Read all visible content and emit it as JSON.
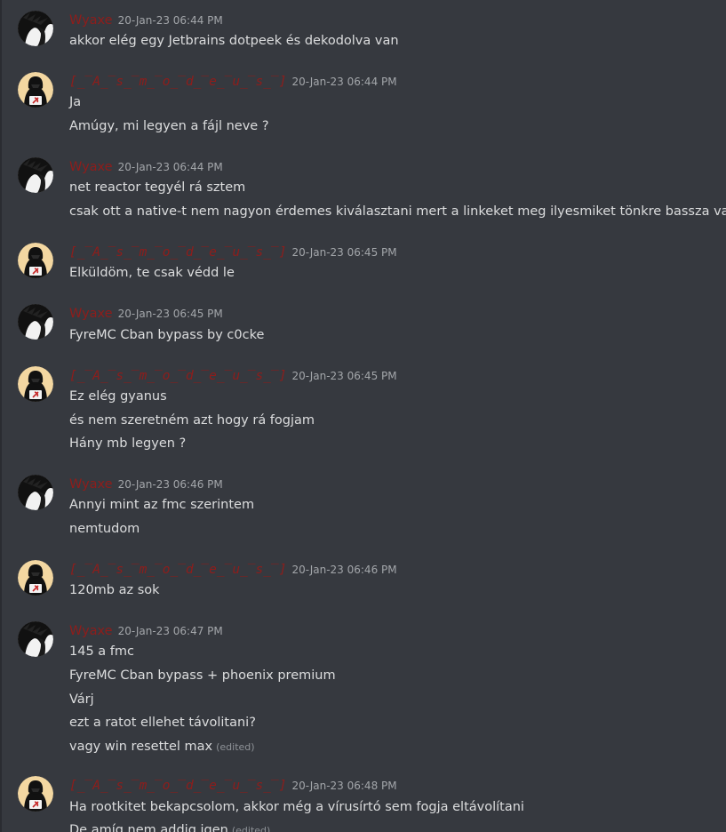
{
  "messages": [
    {
      "author": "Wyaxe",
      "avatar": "wyaxe",
      "timestamp": "20-Jan-23 06:44 PM",
      "lines": [
        {
          "text": "akkor elég egy Jetbrains dotpeek és dekodolva van"
        }
      ]
    },
    {
      "author": "[̲̅A̲̅s̲̅m̲̅o̲̅d̲̅e̲̅u̲̅s̲̅]",
      "avatar": "asmodeus",
      "timestamp": "20-Jan-23 06:44 PM",
      "lines": [
        {
          "text": "Ja"
        },
        {
          "text": "Amúgy, mi legyen a fájl neve ?"
        }
      ]
    },
    {
      "author": "Wyaxe",
      "avatar": "wyaxe",
      "timestamp": "20-Jan-23 06:44 PM",
      "lines": [
        {
          "text": "net reactor tegyél rá sztem"
        },
        {
          "text": "csak ott a native-t nem nagyon érdemes kiválasztani mert a linkeket meg ilyesmiket tönkre bassza valamiért"
        }
      ]
    },
    {
      "author": "[̲̅A̲̅s̲̅m̲̅o̲̅d̲̅e̲̅u̲̅s̲̅]",
      "avatar": "asmodeus",
      "timestamp": "20-Jan-23 06:45 PM",
      "lines": [
        {
          "text": "Elküldöm, te csak védd le"
        }
      ]
    },
    {
      "author": "Wyaxe",
      "avatar": "wyaxe",
      "timestamp": "20-Jan-23 06:45 PM",
      "lines": [
        {
          "text": "FyreMC Cban bypass by c0cke"
        }
      ]
    },
    {
      "author": "[̲̅A̲̅s̲̅m̲̅o̲̅d̲̅e̲̅u̲̅s̲̅]",
      "avatar": "asmodeus",
      "timestamp": "20-Jan-23 06:45 PM",
      "lines": [
        {
          "text": "Ez elég gyanus"
        },
        {
          "text": "és nem szeretném azt hogy rá fogjam"
        },
        {
          "text": "Hány mb legyen ?"
        }
      ]
    },
    {
      "author": "Wyaxe",
      "avatar": "wyaxe",
      "timestamp": "20-Jan-23 06:46 PM",
      "lines": [
        {
          "text": "Annyi mint az fmc szerintem"
        },
        {
          "text": "nemtudom"
        }
      ]
    },
    {
      "author": "[̲̅A̲̅s̲̅m̲̅o̲̅d̲̅e̲̅u̲̅s̲̅]",
      "avatar": "asmodeus",
      "timestamp": "20-Jan-23 06:46 PM",
      "lines": [
        {
          "text": "120mb az sok"
        }
      ]
    },
    {
      "author": "Wyaxe",
      "avatar": "wyaxe",
      "timestamp": "20-Jan-23 06:47 PM",
      "lines": [
        {
          "text": "145 a fmc"
        },
        {
          "text": "FyreMC Cban bypass + phoenix premium"
        },
        {
          "text": "Várj"
        },
        {
          "text": "ezt a ratot ellehet távolitani?"
        },
        {
          "text": "vagy win resettel max",
          "edited": "(edited)"
        }
      ]
    },
    {
      "author": "[̲̅A̲̅s̲̅m̲̅o̲̅d̲̅e̲̅u̲̅s̲̅]",
      "avatar": "asmodeus",
      "timestamp": "20-Jan-23 06:48 PM",
      "lines": [
        {
          "text": "Ha rootkitet bekapcsolom, akkor még a vírusírtó sem fogja eltávolítani"
        },
        {
          "text": "De amíg nem addig igen",
          "edited": "(edited)"
        }
      ]
    }
  ],
  "colors": {
    "background": "#36393f",
    "author_name": "#8e1d1b",
    "message_text": "#dcddde",
    "timestamp": "#a3a6aa"
  }
}
